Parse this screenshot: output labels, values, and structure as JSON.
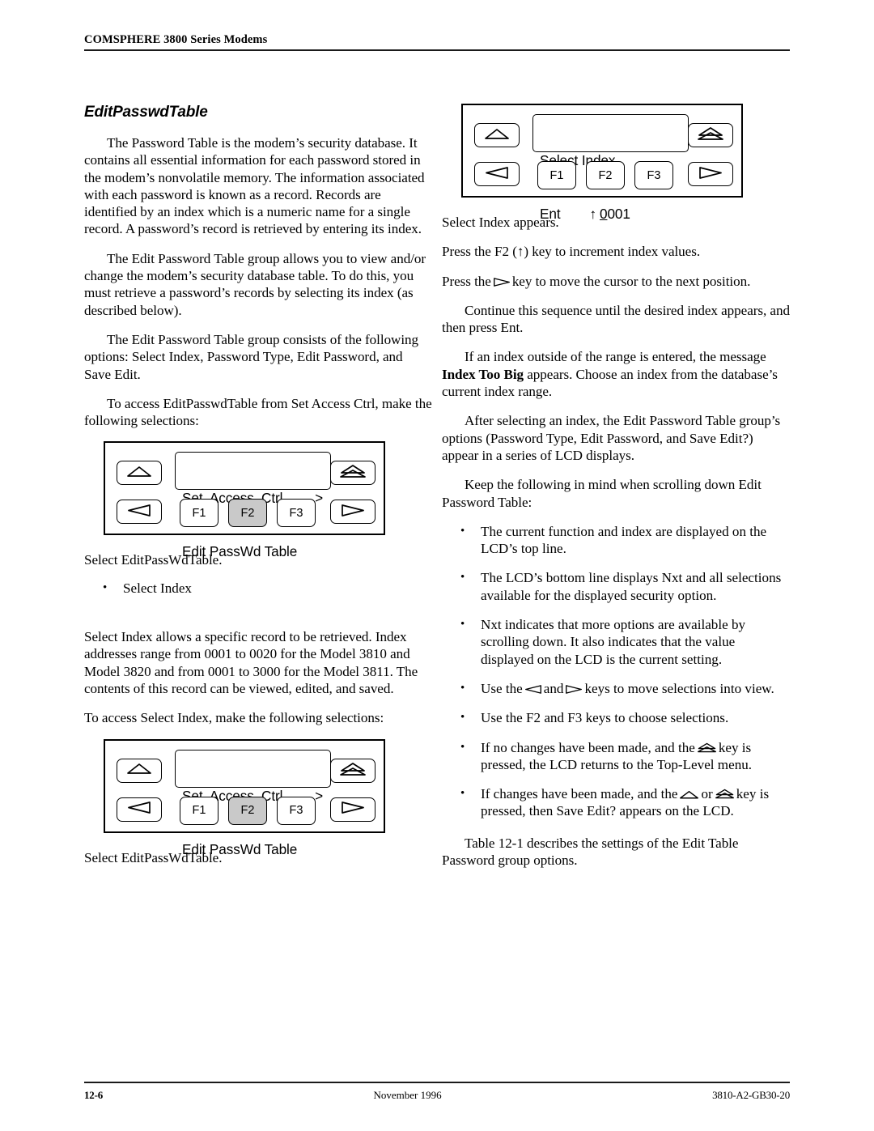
{
  "header": {
    "running_title": "COMSPHERE 3800 Series Modems"
  },
  "left_column": {
    "section_title": "EditPasswdTable",
    "para_1": "The Password Table is the modem’s security database. It contains all essential information for each password stored in the modem’s nonvolatile memory. The information associated with each password is known as a record. Records are identified by an index which is a numeric name for a single record. A password’s record is retrieved by entering its index.",
    "para_2": "The Edit Password Table group allows you to view and/or change the modem’s security database table. To do this, you must retrieve a password’s records by selecting its index (as described below).",
    "para_3": "The Edit Password Table group consists of the following options: Select Index, Password Type, Edit Password, and Save Edit.",
    "para_4": "To access EditPasswdTable from Set Access Ctrl, make the following selections:",
    "caption_1": "Select EditPassWdTable.",
    "bullet_select_index": "Select Index",
    "para_5": "Select Index allows a specific record to be retrieved. Index addresses range from 0001 to 0020 for the Model 3810 and Model 3820 and from 0001 to 3000 for the Model 3811. The contents of this record can be viewed, edited, and saved.",
    "para_6": "To access Select Index, make the following selections:",
    "caption_2": "Select EditPassWdTable."
  },
  "right_column": {
    "para_1": "Select Index appears.",
    "para_2_a": "Press the F2 (",
    "para_2_b": ") key to increment index values.",
    "para_3_a": "Press the",
    "para_3_b": "key to move the cursor to the next position.",
    "para_4": "Continue this sequence until the desired index appears, and then press Ent.",
    "para_5_a": "If an index outside of the range is entered, the message",
    "para_5_bold": "Index Too Big",
    "para_5_b": "appears. Choose an index from the database’s current index range.",
    "para_6": "After selecting an index, the Edit Password Table group’s options (Password Type, Edit Password, and Save Edit?) appear in a series of LCD displays.",
    "para_7": "Keep the following in mind when scrolling down Edit Password Table:",
    "bullets": [
      {
        "text": "The current function and index are displayed on the LCD’s top line."
      },
      {
        "text": "The LCD’s bottom line displays Nxt and all selections available for the displayed security option."
      },
      {
        "text": "Nxt indicates that more options are available by scrolling down. It also indicates that the value displayed on the LCD is the current setting."
      }
    ],
    "bullet_keys_a": "Use the",
    "bullet_keys_and": "and",
    "bullet_keys_b": "keys to move selections into view.",
    "bullet_f2f3": "Use the F2 and F3 keys to choose selections.",
    "bullet_nochanges_a": "If no changes have been made, and the",
    "bullet_nochanges_b": "key is pressed, the LCD returns to the Top-Level menu.",
    "bullet_changes_a": "If changes have been made, and the",
    "bullet_changes_or": "or",
    "bullet_changes_b": "key is pressed, then Save Edit? appears on the LCD.",
    "para_8": "Table 12-1 describes the settings of the Edit Table Password group options."
  },
  "panels": {
    "set_access_ctrl_1": {
      "lcd_line1_left": "Set  Access  Ctrl",
      "lcd_line1_right": ">",
      "lcd_line2_left": "Edit PassWd Table",
      "lcd_line2_right": "",
      "f1_label": "F1",
      "f2_label": "F2",
      "f3_label": "F3",
      "selected_key": "F2"
    },
    "set_access_ctrl_2": {
      "lcd_line1_left": "Set  Access  Ctrl",
      "lcd_line1_right": ">",
      "lcd_line2_left": "Edit PassWd Table",
      "lcd_line2_right": "",
      "f1_label": "F1",
      "f2_label": "F2",
      "f3_label": "F3",
      "selected_key": "F2"
    },
    "select_index": {
      "lcd_line1_left": "Select Index",
      "lcd_line1_right": "",
      "lcd_line2_left": "Ent",
      "lcd_line2_cursor": "0",
      "lcd_line2_rest": "001",
      "lcd_line2_arrow": "↑",
      "f1_label": "F1",
      "f2_label": "F2",
      "f3_label": "F3",
      "selected_key": ""
    }
  },
  "footer": {
    "page_number": "12-6",
    "date": "November 1996",
    "doc_number": "3810-A2-GB30-20"
  },
  "colors": {
    "text": "#000000",
    "rule": "#1a1a1a",
    "key_selected": "#c9c9c9",
    "panel_border": "#000000"
  }
}
